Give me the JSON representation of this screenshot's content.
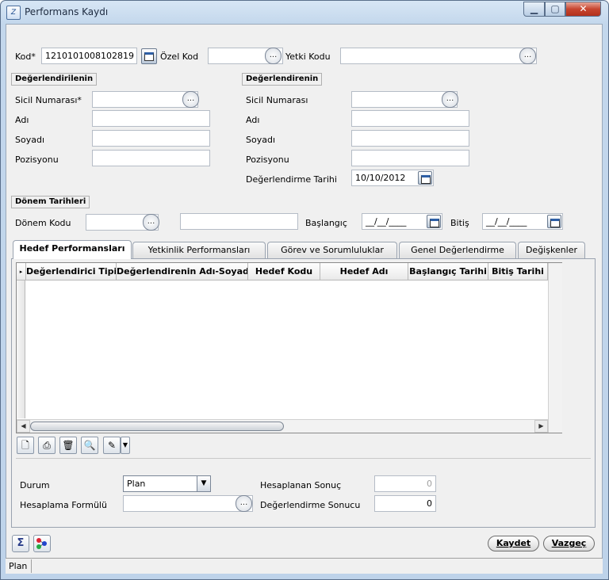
{
  "window": {
    "title": "Performans Kaydı",
    "min_glyph": "▁",
    "max_glyph": "▢",
    "close_glyph": "✕",
    "app_icon_text": "Z"
  },
  "header": {
    "kod_label": "Kod*",
    "kod_value": "1210101008102819",
    "ozel_kod_label": "Özel Kod",
    "ozel_kod_value": "",
    "yetki_kodu_label": "Yetki Kodu",
    "yetki_kodu_value": "",
    "ellipsis": "..."
  },
  "degerlendirilen": {
    "title": "Değerlendirilenin",
    "sicil_label": "Sicil Numarası*",
    "adi_label": "Adı",
    "soyadi_label": "Soyadı",
    "pozisyon_label": "Pozisyonu"
  },
  "degerlendiren": {
    "title": "Değerlendirenin",
    "sicil_label": "Sicil Numarası",
    "adi_label": "Adı",
    "soyadi_label": "Soyadı",
    "pozisyon_label": "Pozisyonu",
    "tarih_label": "Değerlendirme Tarihi",
    "tarih_value": "10/10/2012"
  },
  "donem": {
    "title": "Dönem Tarihleri",
    "kod_label": "Dönem Kodu",
    "baslangic_label": "Başlangıç",
    "baslangic_value": "__/__/____",
    "bitis_label": "Bitiş",
    "bitis_value": "__/__/____"
  },
  "tabs": [
    {
      "label": "Hedef Performansları"
    },
    {
      "label": "Yetkinlik Performansları"
    },
    {
      "label": "Görev ve Sorumluluklar"
    },
    {
      "label": "Genel Değerlendirme"
    },
    {
      "label": "Değişkenler"
    }
  ],
  "grid": {
    "columns": [
      "Değerlendirici Tipi",
      "Değerlendirenin Adı-Soyadı",
      "Hedef Kodu",
      "Hedef Adı",
      "Başlangıç Tarihi",
      "Bitiş Tarihi"
    ],
    "scroll_left": "◀",
    "scroll_right": "▶",
    "row_marker": "▸"
  },
  "bottom": {
    "durum_label": "Durum",
    "durum_value": "Plan",
    "formul_label": "Hesaplama Formülü",
    "hesaplanan_label": "Hesaplanan Sonuç",
    "hesaplanan_value": "0",
    "sonuc_label": "Değerlendirme Sonucu",
    "sonuc_value": "0"
  },
  "footer": {
    "kaydet_label": "Kaydet",
    "vazgec_label": "Vazgeç",
    "sigma_glyph": "Σ",
    "status_text": "Plan"
  }
}
